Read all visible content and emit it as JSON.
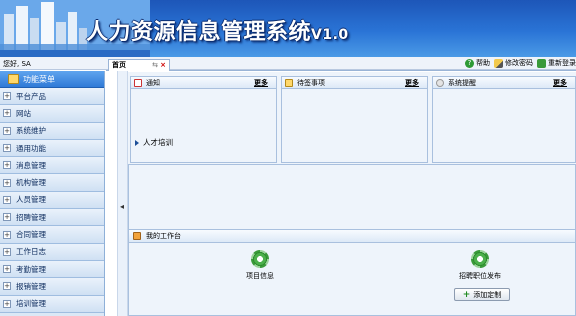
{
  "banner": {
    "title": "人力资源信息管理系统",
    "version": "V1.0"
  },
  "topbar": {
    "greeting": "您好, SA",
    "help": "帮助",
    "change_password": "修改密码",
    "relogin": "重新登录"
  },
  "tabs": [
    {
      "label": "首页"
    }
  ],
  "sidebar": {
    "header": "功能菜单",
    "items": [
      {
        "label": "平台产品"
      },
      {
        "label": "网站"
      },
      {
        "label": "系统维护"
      },
      {
        "label": "通用功能"
      },
      {
        "label": "消息管理"
      },
      {
        "label": "机构管理"
      },
      {
        "label": "人员管理"
      },
      {
        "label": "招聘管理"
      },
      {
        "label": "合同管理"
      },
      {
        "label": "工作日志"
      },
      {
        "label": "考勤管理"
      },
      {
        "label": "报销管理"
      },
      {
        "label": "培训管理"
      }
    ]
  },
  "panels": {
    "notice": {
      "title": "通知",
      "more": "更多",
      "items": [
        "人才培训"
      ]
    },
    "todo": {
      "title": "待签事项",
      "more": "更多"
    },
    "reminder": {
      "title": "系统提醒",
      "more": "更多"
    }
  },
  "workbench": {
    "title": "我的工作台",
    "shortcuts": [
      {
        "label": "项目信息"
      },
      {
        "label": "招聘职位发布"
      }
    ],
    "add_button": "添加定制"
  },
  "colors": {
    "banner": "#2a74d6",
    "sidebar": "#dbe8f6",
    "content": "#eef4fb"
  }
}
